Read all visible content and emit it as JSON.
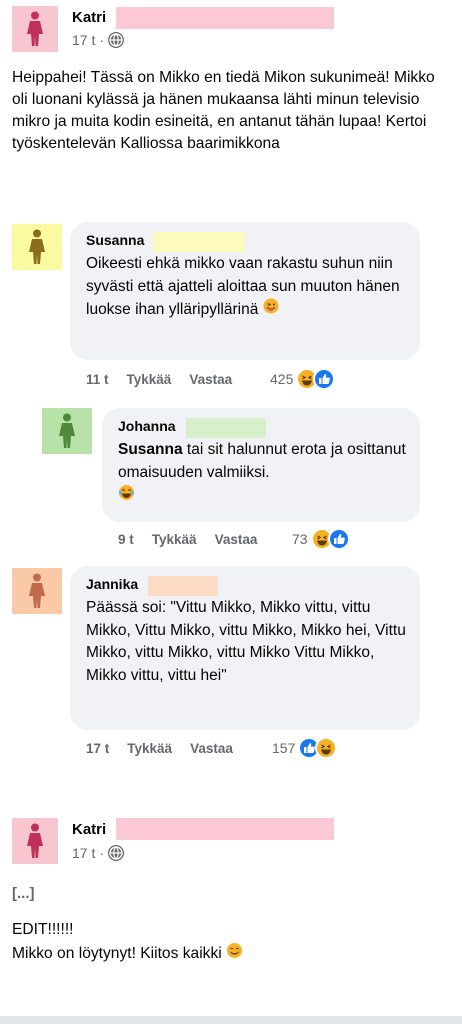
{
  "post1": {
    "author": "Katri",
    "time": "17 t",
    "separator": "·",
    "body": "Heippahei! Tässä on Mikko en tiedä Mikon sukunimeä! Mikko oli luonani kylässä ja hänen mukaansa lähti minun televisio mikro ja muita kodin esineitä, en antanut tähän lupaa! Kertoi työskentelevän Kalliossa baarimikkona"
  },
  "comments": [
    {
      "author": "Susanna",
      "text": "Oikeesti ehkä mikko vaan rakastu suhun niin syvästi että ajatteli aloittaa sun muuton hänen luokse ihan ylläripyllärinä",
      "time": "11 t",
      "like_label": "Tykkää",
      "reply_label": "Vastaa",
      "reaction_count": "425"
    },
    {
      "author": "Johanna",
      "mention": "Susanna",
      "text": " tai sit halunnut erota ja osittanut omaisuuden valmiiksi.",
      "time": "9 t",
      "like_label": "Tykkää",
      "reply_label": "Vastaa",
      "reaction_count": "73"
    },
    {
      "author": "Jannika",
      "text": "Päässä soi: \"Vittu Mikko, Mikko vittu, vittu Mikko, Vittu Mikko, vittu Mikko, Mikko hei, Vittu Mikko, vittu Mikko, vittu Mikko Vittu Mikko, Mikko vittu, vittu hei\"",
      "time": "17 t",
      "like_label": "Tykkää",
      "reply_label": "Vastaa",
      "reaction_count": "157"
    }
  ],
  "post2": {
    "author": "Katri",
    "time": "17 t",
    "separator": "·",
    "ellipsis": "[...]",
    "edit": "EDIT!!!!!!",
    "body": "Mikko on löytynyt! Kiitos kaikki"
  },
  "colors": {
    "katri_avatar": "#f7c6cf",
    "katri_figure": "#c0305a",
    "katri_redact": "#fbc8d4",
    "susanna_avatar": "#fafaa0",
    "susanna_figure": "#8a6d1a",
    "susanna_redact": "#fbfbbe",
    "johanna_avatar": "#b8e2a8",
    "johanna_figure": "#4e8a3a",
    "johanna_redact": "#d7f0cc",
    "jannika_avatar": "#f9c9a8",
    "jannika_figure": "#c26a4a",
    "jannika_redact": "#fcdcc4",
    "like_blue": "#1877f2",
    "meta_gray": "#65676b",
    "bubble_bg": "#f0f2f5"
  },
  "icons": {
    "avatar": "person-figure-icon",
    "globe": "globe-icon",
    "like": "like-thumb-icon",
    "haha": "haha-emoji-icon",
    "tongue": "tongue-out-emoji-icon",
    "laugh_tears": "tears-of-joy-emoji-icon",
    "smile": "smiling-emoji-icon"
  }
}
